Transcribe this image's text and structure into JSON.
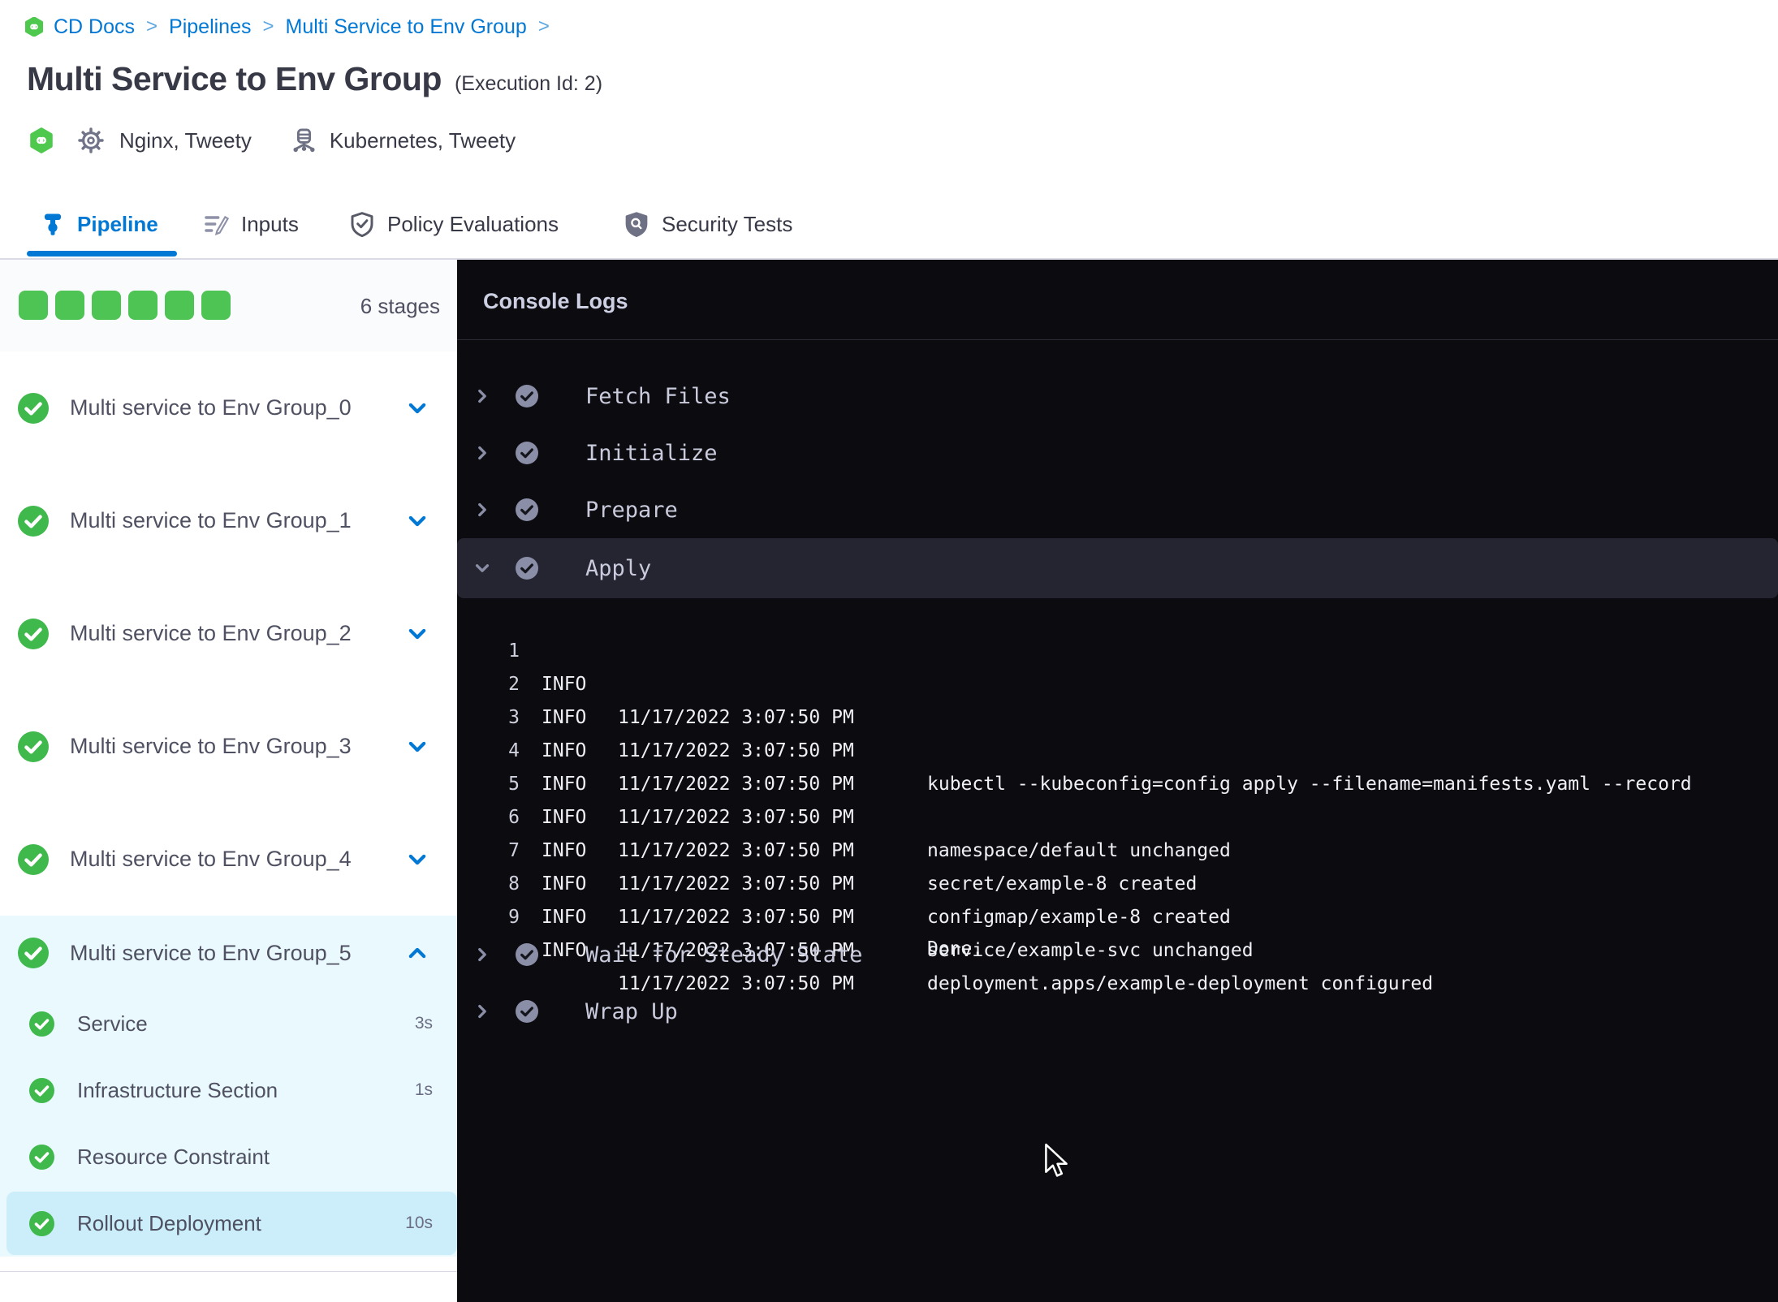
{
  "breadcrumb": {
    "items": [
      "CD Docs",
      "Pipelines",
      "Multi Service to Env Group"
    ],
    "separator": ">"
  },
  "header": {
    "title": "Multi Service to Env Group",
    "execution_id": "(Execution Id: 2)",
    "services": "Nginx, Tweety",
    "environment": "Kubernetes, Tweety"
  },
  "tabs": {
    "pipeline": "Pipeline",
    "inputs": "Inputs",
    "policy": "Policy Evaluations",
    "security": "Security Tests"
  },
  "sidebar": {
    "stage_count": "6 stages",
    "stages": [
      {
        "label": "Multi service to Env Group_0"
      },
      {
        "label": "Multi service to Env Group_1"
      },
      {
        "label": "Multi service to Env Group_2"
      },
      {
        "label": "Multi service to Env Group_3"
      },
      {
        "label": "Multi service to Env Group_4"
      },
      {
        "label": "Multi service to Env Group_5",
        "expanded": true,
        "steps": [
          {
            "label": "Service",
            "duration": "3s"
          },
          {
            "label": "Infrastructure Section",
            "duration": "1s"
          },
          {
            "label": "Resource Constraint",
            "duration": ""
          },
          {
            "label": "Rollout Deployment",
            "duration": "10s",
            "selected": true
          }
        ]
      }
    ]
  },
  "console": {
    "title": "Console Logs",
    "sections": [
      {
        "label": "Fetch Files",
        "expanded": false
      },
      {
        "label": "Initialize",
        "expanded": false
      },
      {
        "label": "Prepare",
        "expanded": false
      },
      {
        "label": "Apply",
        "expanded": true
      },
      {
        "label": "Wait for Steady State",
        "expanded": false
      },
      {
        "label": "Wrap Up",
        "expanded": false
      }
    ],
    "logs": [
      {
        "n": "1",
        "level": "INFO",
        "time": "11/17/2022 3:07:50 PM",
        "msg": ""
      },
      {
        "n": "2",
        "level": "INFO",
        "time": "11/17/2022 3:07:50 PM",
        "msg": "kubectl --kubeconfig=config apply --filename=manifests.yaml --record"
      },
      {
        "n": "3",
        "level": "INFO",
        "time": "11/17/2022 3:07:50 PM",
        "msg": ""
      },
      {
        "n": "4",
        "level": "INFO",
        "time": "11/17/2022 3:07:50 PM",
        "msg": "namespace/default unchanged"
      },
      {
        "n": "5",
        "level": "INFO",
        "time": "11/17/2022 3:07:50 PM",
        "msg": "secret/example-8 created"
      },
      {
        "n": "6",
        "level": "INFO",
        "time": "11/17/2022 3:07:50 PM",
        "msg": "configmap/example-8 created"
      },
      {
        "n": "7",
        "level": "INFO",
        "time": "11/17/2022 3:07:50 PM",
        "msg": "service/example-svc unchanged"
      },
      {
        "n": "8",
        "level": "INFO",
        "time": "11/17/2022 3:07:50 PM",
        "msg": "deployment.apps/example-deployment configured"
      },
      {
        "n": "9",
        "level": "INFO",
        "time": "11/17/2022 3:07:50 PM",
        "msg": ""
      }
    ],
    "done_line": "Done."
  },
  "colors": {
    "primary_blue": "#0278d5",
    "success_green": "#4ec455",
    "console_bg": "#0c0c10",
    "selected_step_bg": "#cbeefa",
    "expanded_stage_bg": "#e9f9fe"
  }
}
